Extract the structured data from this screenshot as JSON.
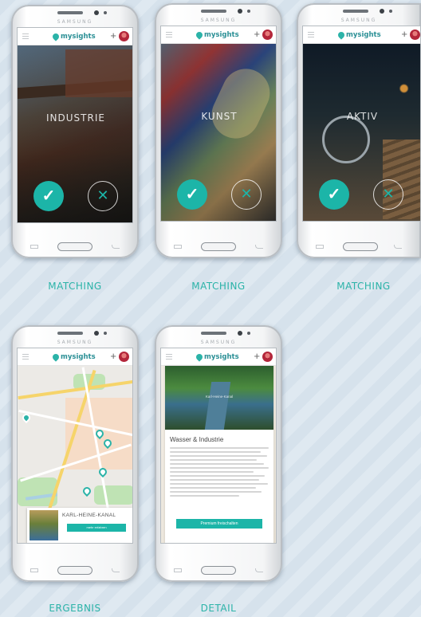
{
  "app": {
    "device_brand": "SAMSUNG",
    "logo_text": "mysights"
  },
  "colors": {
    "accent": "#1cb5a8",
    "caption": "#2bb3a8",
    "background": "#d6e2ec"
  },
  "icons": {
    "menu": "hamburger-menu-icon",
    "logo": "map-pin-icon",
    "add": "plus-icon",
    "profile": "avatar",
    "accept": "check-icon",
    "reject": "close-icon"
  },
  "screens": [
    {
      "caption": "MATCHING",
      "category": "INDUSTRIE",
      "accept_glyph": "✓",
      "reject_glyph": "✕"
    },
    {
      "caption": "MATCHING",
      "category": "KUNST",
      "accept_glyph": "✓",
      "reject_glyph": "✕"
    },
    {
      "caption": "MATCHING",
      "category": "AKTIV",
      "accept_glyph": "✓",
      "reject_glyph": "✕"
    },
    {
      "caption": "ERGEBNIS",
      "result_title": "KARL-HEINE-KANAL",
      "result_button": "mehr erfahren"
    },
    {
      "caption": "DETAIL",
      "photo_caption": "Karl-Heine-Kanal",
      "title": "Wasser & Industrie",
      "button": "Premium freischalten"
    }
  ]
}
